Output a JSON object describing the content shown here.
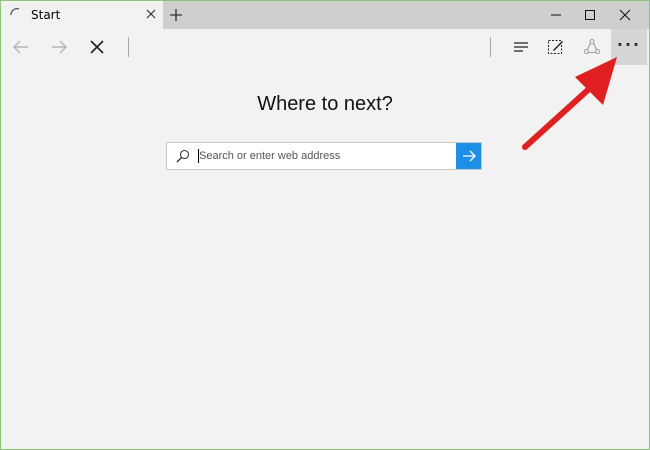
{
  "tab": {
    "title": "Start"
  },
  "page": {
    "heading": "Where to next?"
  },
  "search": {
    "placeholder": "Search or enter web address"
  },
  "colors": {
    "accent": "#1e8fe6",
    "annotation_arrow": "#e02020"
  },
  "icons": {
    "tab_loading": "loading-spinner-icon",
    "tab_close": "close-icon",
    "new_tab": "plus-icon",
    "minimize": "minimize-icon",
    "maximize": "maximize-icon",
    "close_window": "close-icon",
    "back": "arrow-left-icon",
    "forward": "arrow-right-icon",
    "stop": "close-icon",
    "hub": "hub-lines-icon",
    "web_note": "pen-note-icon",
    "share": "share-icon",
    "more": "more-dots-icon",
    "search": "search-icon",
    "go": "arrow-right-icon"
  },
  "more_button": {
    "label": "···"
  }
}
